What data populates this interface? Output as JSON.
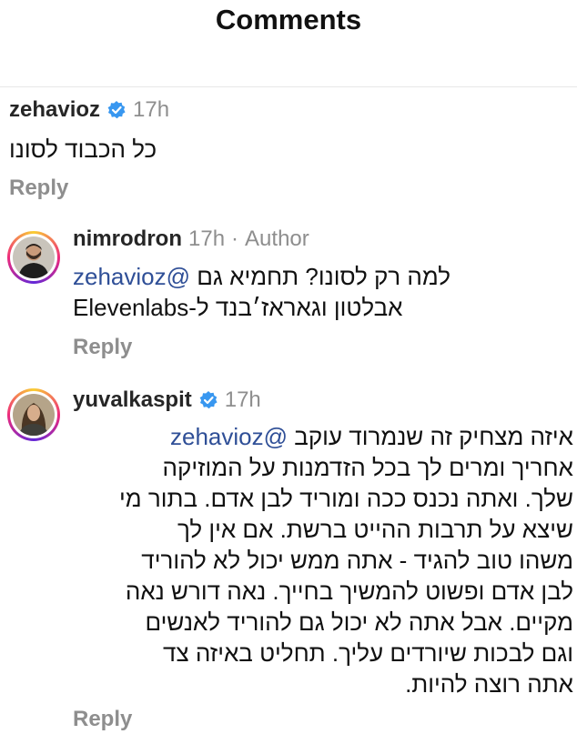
{
  "header": {
    "title": "Comments"
  },
  "comments": [
    {
      "username": "zehavioz",
      "time": "17h",
      "text": "כל הכבוד לסונו",
      "reply_label": "Reply"
    },
    {
      "username": "nimrodron",
      "time": "17h",
      "separator": "·",
      "author_label": "Author",
      "mention": "@zehavioz",
      "line1": "למה רק לסונו? תחמיא גם",
      "line2": "אבלטון וגאראז׳בנד ל-Elevenlabs",
      "reply_label": "Reply"
    },
    {
      "username": "yuvalkaspit",
      "time": "17h",
      "mention": "@zehavioz",
      "lines": [
        "איזה מצחיק זה שנמרוד עוקב",
        "אחריך ומרים לך בכל הזדמנות על המוזיקה",
        "שלך. ואתה נכנס ככה ומוריד לבן אדם. בתור מי",
        "שיצא על תרבות ההייט ברשת. אם אין לך",
        "משהו טוב להגיד - אתה ממש יכול לא להוריד",
        "לבן אדם ופשוט להמשיך בחייך. נאה דורש נאה",
        "מקיים.  אבל אתה לא יכול גם להוריד לאנשים",
        "וגם לבכות שיורדים עליך. תחליט באיזה צד",
        "אתה רוצה להיות."
      ],
      "reply_label": "Reply"
    }
  ],
  "icons": {
    "verified": "verified-badge-icon",
    "avatar_nimrod": "avatar",
    "avatar_yuval": "avatar"
  },
  "colors": {
    "mention": "#2f4f97",
    "verified": "#3897f0",
    "muted": "#8e8e8e",
    "divider": "#e8e8e8"
  }
}
